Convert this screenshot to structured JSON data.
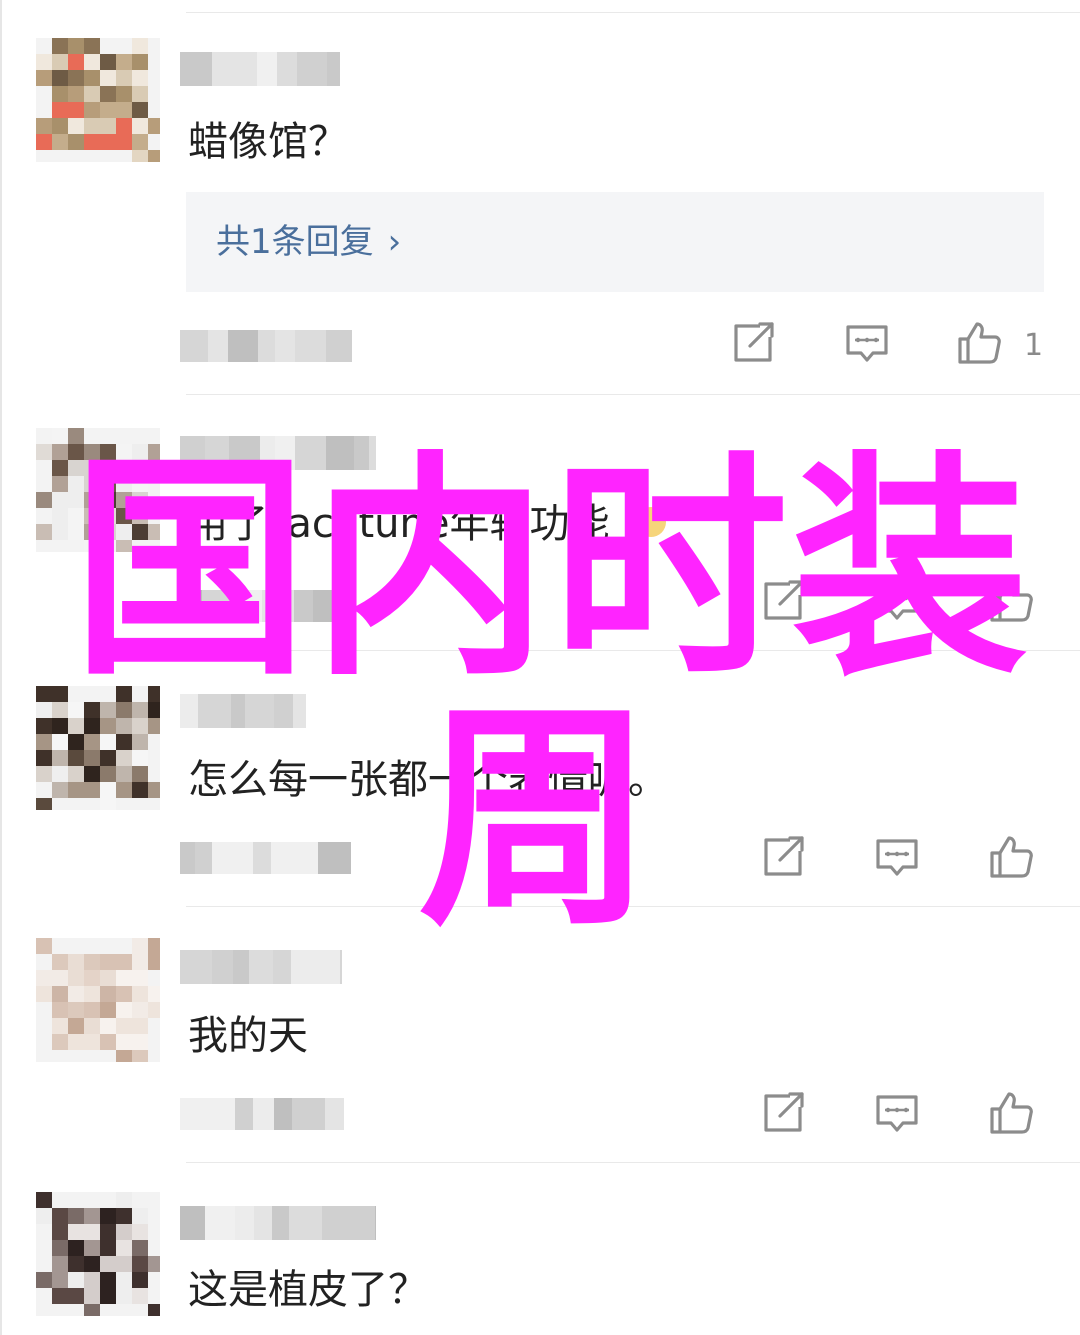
{
  "comments": [
    {
      "text": "蜡像馆？",
      "reply_summary": "共1条回复",
      "like_count": "1"
    },
    {
      "text": "用了Facetune年轻功能",
      "like_count": ""
    },
    {
      "text": "怎么每一张都一个表情呢。",
      "like_count": ""
    },
    {
      "text": "我的天",
      "like_count": ""
    },
    {
      "text": "这是植皮了？"
    }
  ],
  "reply_chevron": "›",
  "watermark": {
    "line1": "国内时装",
    "line2": "周"
  },
  "icons": {
    "share": "share-edit-icon",
    "comment": "comment-bubble-icon",
    "like": "thumbs-up-icon"
  },
  "colors": {
    "text": "#222222",
    "link": "#4a6f9c",
    "muted": "#8a8a8a",
    "watermark": "#ff24ff"
  }
}
